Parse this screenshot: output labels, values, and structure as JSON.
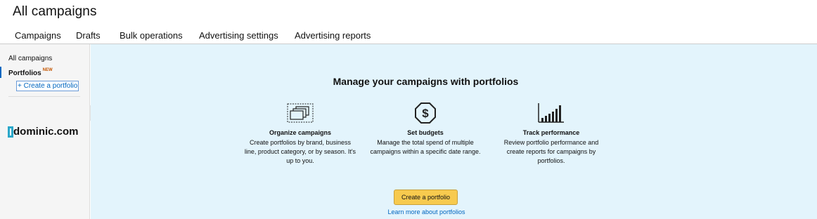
{
  "header": {
    "title": "All campaigns"
  },
  "tabs": [
    {
      "label": "Campaigns"
    },
    {
      "label": "Drafts"
    },
    {
      "label": "Bulk operations"
    },
    {
      "label": "Advertising settings"
    },
    {
      "label": "Advertising reports"
    }
  ],
  "sidebar": {
    "all_campaigns": "All campaigns",
    "portfolios": "Portfolios",
    "new_badge": "NEW",
    "create_portfolio": "+ Create a portfolio",
    "logo_text": "dominic.com",
    "collapse_glyph": "«"
  },
  "main": {
    "headline": "Manage your campaigns with portfolios",
    "features": [
      {
        "icon": "stacked-cards-icon",
        "title": "Organize campaigns",
        "description": "Create portfolios by brand, business line, product category, or by season. It's up to you."
      },
      {
        "icon": "dollar-octagon-icon",
        "title": "Set budgets",
        "description": "Manage the total spend of multiple campaigns within a specific date range."
      },
      {
        "icon": "bar-chart-icon",
        "title": "Track performance",
        "description": "Review portfolio performance and create reports for campaigns by portfolios."
      }
    ],
    "create_button": "Create a portfolio",
    "learn_more": "Learn more about portfolios"
  },
  "colors": {
    "accent_link": "#0066c0",
    "cta_button": "#f7ca4e",
    "main_background": "#e3f4fc",
    "new_badge": "#c45500"
  }
}
